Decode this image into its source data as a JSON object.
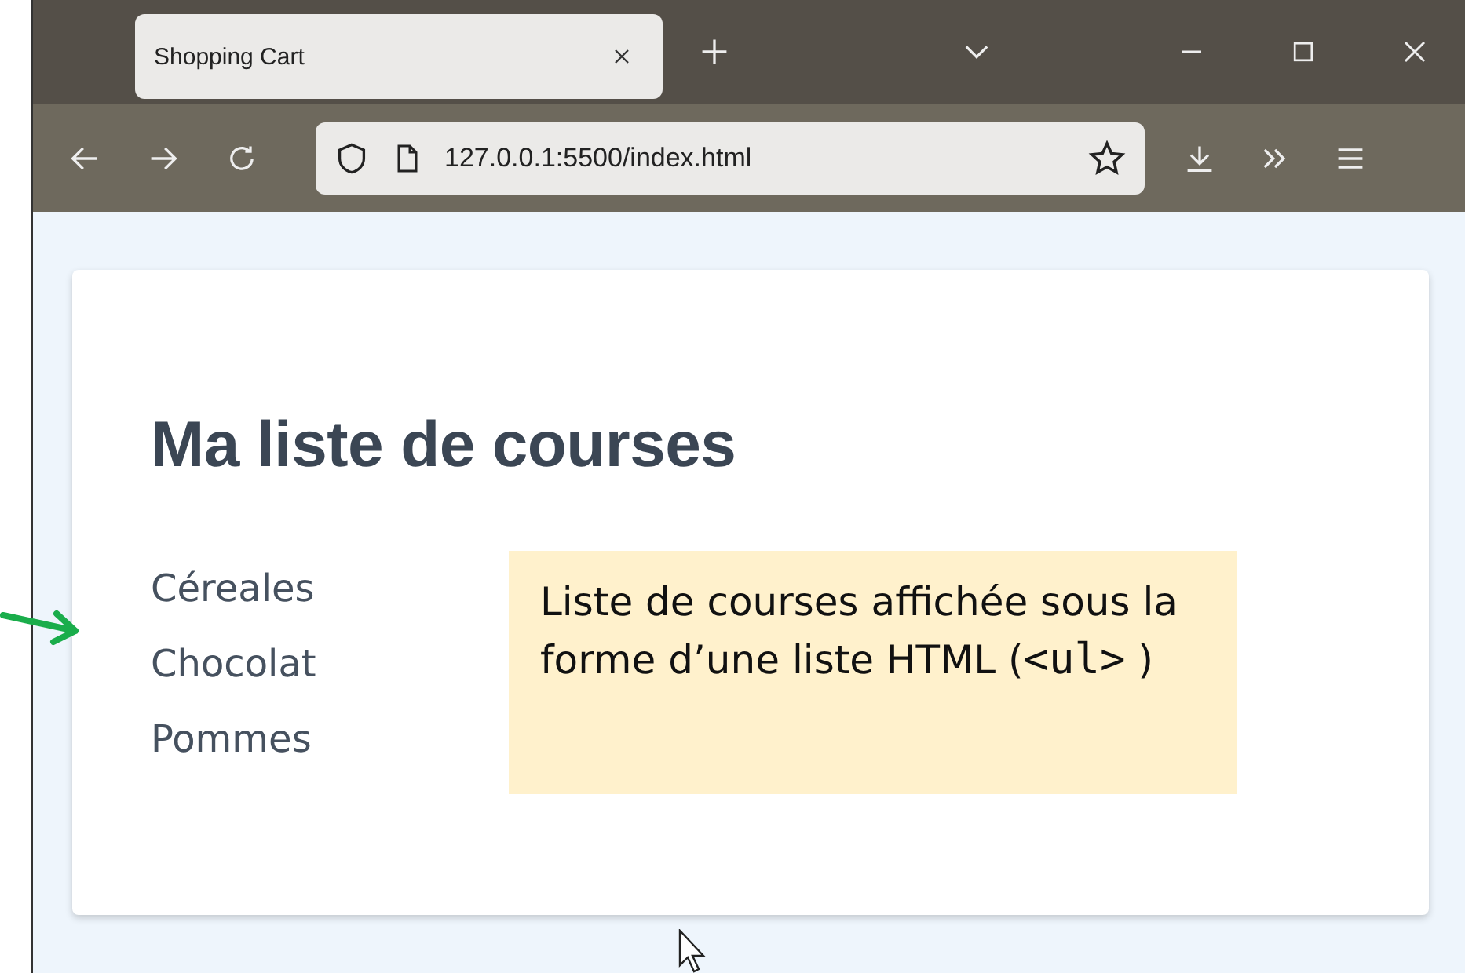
{
  "browser": {
    "tab": {
      "title": "Shopping Cart",
      "selected": true
    },
    "address": "127.0.0.1:5500/index.html"
  },
  "page": {
    "heading": "Ma liste de courses",
    "items": [
      "Céreales",
      "Chocolat",
      "Pommes"
    ]
  },
  "note": {
    "text": "Liste de courses affichée sous la forme d’une liste HTML (",
    "code": "<ul>",
    "text_end": " )"
  }
}
